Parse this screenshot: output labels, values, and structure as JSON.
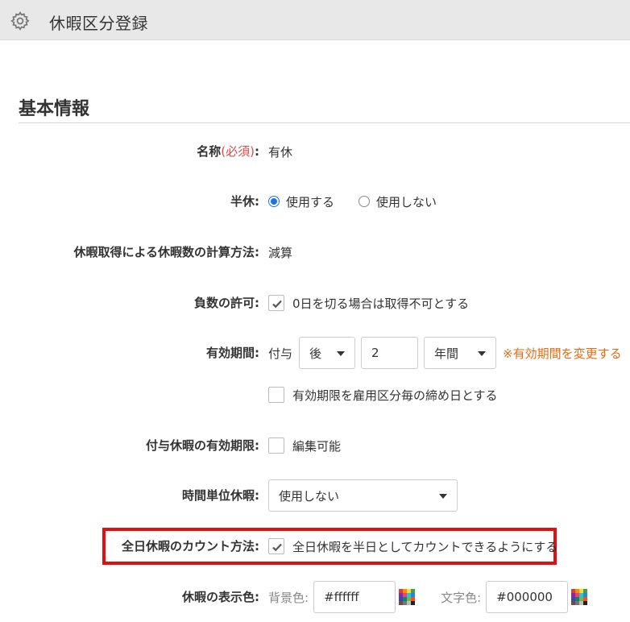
{
  "header": {
    "title": "休暇区分登録",
    "icon": "gear-icon"
  },
  "section": {
    "title": "基本情報"
  },
  "fields": {
    "name": {
      "label": "名称",
      "required": "(必須)",
      "colon": ":",
      "value": "有休"
    },
    "half_day": {
      "label": "半休:",
      "options": [
        "使用する",
        "使用しない"
      ],
      "selected": "使用する"
    },
    "calc_method": {
      "label": "休暇取得による休暇数の計算方法:",
      "value": "減算"
    },
    "negative": {
      "label": "負数の許可:",
      "checked": true,
      "text": "0日を切る場合は取得不可とする"
    },
    "validity": {
      "label": "有効期間:",
      "prefix": "付与",
      "direction": "後",
      "amount": "2",
      "unit": "年間",
      "note": "※有効期間を変更する",
      "closing_checked": false,
      "closing_text": "有効期限を雇用区分毎の締め日とする"
    },
    "grant_expiry": {
      "label": "付与休暇の有効期限:",
      "checked": false,
      "text": "編集可能"
    },
    "hourly": {
      "label": "時間単位休暇:",
      "value": "使用しない"
    },
    "count_method": {
      "label": "全日休暇のカウント方法:",
      "checked": true,
      "text": "全日休暇を半日としてカウントできるようにする"
    },
    "display_color": {
      "label": "休暇の表示色:",
      "bg_label": "背景色:",
      "bg_value": "#ffffff",
      "fg_label": "文字色:",
      "fg_value": "#000000"
    }
  },
  "colors": {
    "accent": "#1a73e8",
    "required": "#e04848",
    "note": "#e86a10",
    "highlight": "#e01010"
  }
}
